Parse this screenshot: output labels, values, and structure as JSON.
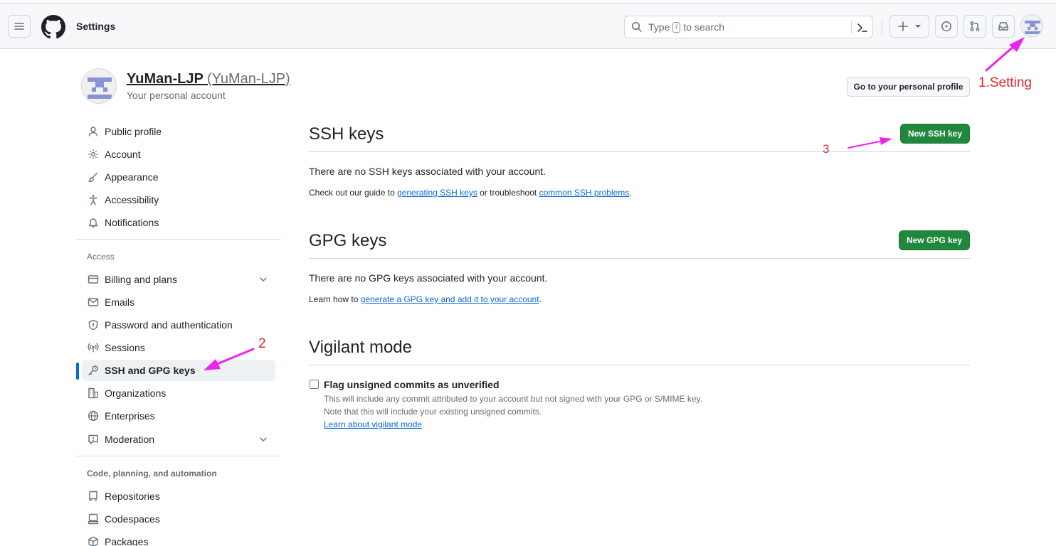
{
  "header": {
    "title": "Settings",
    "search_prefix": "Type",
    "search_key": "/",
    "search_suffix": "to search",
    "icons": [
      "hamburger-icon",
      "github-logo",
      "search-icon",
      "command-palette-icon",
      "plus-icon",
      "chevron-down-icon",
      "issues-icon",
      "pull-requests-icon",
      "inbox-icon"
    ]
  },
  "profile": {
    "name": "YuMan-LJP",
    "handle": "(YuMan-LJP)",
    "subtitle": "Your personal account",
    "go_profile_label": "Go to your personal profile"
  },
  "sidebar": {
    "items_top": [
      {
        "label": "Public profile",
        "icon": "person-icon"
      },
      {
        "label": "Account",
        "icon": "gear-icon"
      },
      {
        "label": "Appearance",
        "icon": "paintbrush-icon"
      },
      {
        "label": "Accessibility",
        "icon": "accessibility-icon"
      },
      {
        "label": "Notifications",
        "icon": "bell-icon"
      }
    ],
    "access_heading": "Access",
    "items_access": [
      {
        "label": "Billing and plans",
        "icon": "credit-card-icon"
      },
      {
        "label": "Emails",
        "icon": "mail-icon"
      },
      {
        "label": "Password and authentication",
        "icon": "shield-icon"
      },
      {
        "label": "Sessions",
        "icon": "broadcast-icon"
      },
      {
        "label": "SSH and GPG keys",
        "icon": "key-icon"
      },
      {
        "label": "Organizations",
        "icon": "organization-icon"
      },
      {
        "label": "Enterprises",
        "icon": "globe-icon"
      },
      {
        "label": "Moderation",
        "icon": "report-icon"
      }
    ],
    "code_heading": "Code, planning, and automation",
    "items_code": [
      {
        "label": "Repositories",
        "icon": "repo-icon"
      },
      {
        "label": "Codespaces",
        "icon": "codespaces-icon"
      },
      {
        "label": "Packages",
        "icon": "package-icon"
      }
    ]
  },
  "ssh": {
    "heading": "SSH keys",
    "button": "New SSH key",
    "empty": "There are no SSH keys associated with your account.",
    "guide_prefix": "Check out our guide to",
    "guide_link1": "generating SSH keys",
    "guide_mid": "or troubleshoot",
    "guide_link2": "common SSH problems",
    "guide_end": "."
  },
  "gpg": {
    "heading": "GPG keys",
    "button": "New GPG key",
    "empty": "There are no GPG keys associated with your account.",
    "learn_prefix": "Learn how to",
    "learn_link": "generate a GPG key and add it to your account",
    "learn_end": "."
  },
  "vigilant": {
    "heading": "Vigilant mode",
    "checkbox_label": "Flag unsigned commits as unverified",
    "checked": false,
    "note1": "This will include any commit attributed to your account but not signed with your GPG or S/MIME key.",
    "note2": "Note that this will include your existing unsigned commits.",
    "learn_link": "Learn about vigilant mode",
    "learn_end": "."
  },
  "annotations": {
    "a1": "1.Setting",
    "a2": "2",
    "a3": "3",
    "color": "#e4262c",
    "arrow_color": "#ee22ee"
  },
  "colors": {
    "accent": "#0969da",
    "primary_button": "#1f883d",
    "header_bg": "#f6f8fa"
  }
}
